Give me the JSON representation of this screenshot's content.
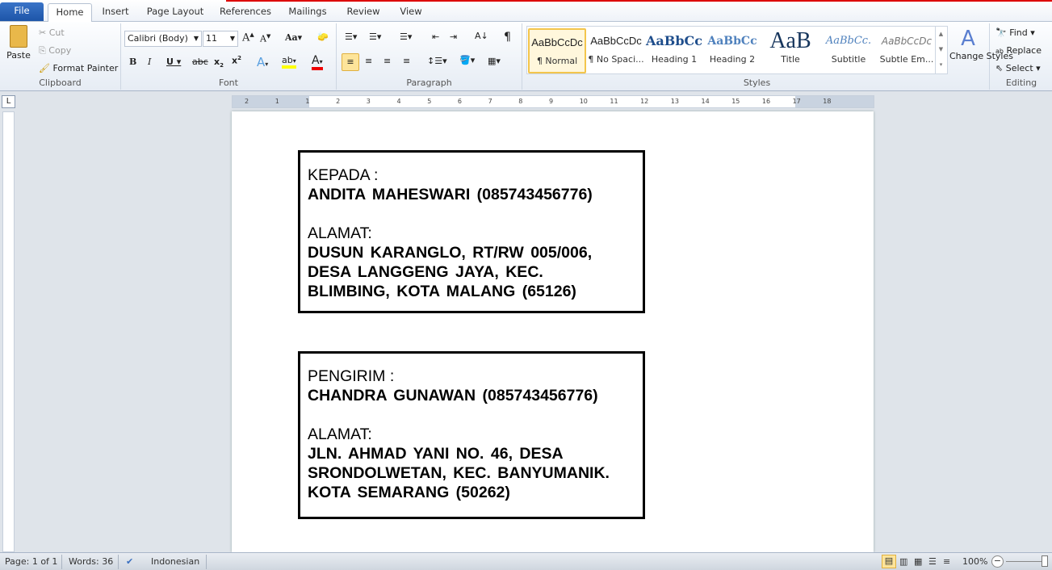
{
  "tabs": [
    "File",
    "Home",
    "Insert",
    "Page Layout",
    "References",
    "Mailings",
    "Review",
    "View"
  ],
  "clipboard": {
    "paste": "Paste",
    "cut": "Cut",
    "copy": "Copy",
    "format_painter": "Format Painter",
    "label": "Clipboard"
  },
  "font": {
    "name": "Calibri (Body)",
    "size": "11",
    "label": "Font"
  },
  "paragraph": {
    "label": "Paragraph"
  },
  "styles": {
    "label": "Styles",
    "items": [
      {
        "preview": "AaBbCcDc",
        "name": "¶ Normal"
      },
      {
        "preview": "AaBbCcDc",
        "name": "¶ No Spaci..."
      },
      {
        "preview": "AaBbCc",
        "name": "Heading 1"
      },
      {
        "preview": "AaBbCc",
        "name": "Heading 2"
      },
      {
        "preview": "AaB",
        "name": "Title"
      },
      {
        "preview": "AaBbCc.",
        "name": "Subtitle"
      },
      {
        "preview": "AaBbCcDc",
        "name": "Subtle Em..."
      }
    ],
    "change_styles": "Change Styles"
  },
  "editing": {
    "find": "Find",
    "replace": "Replace",
    "select": "Select",
    "label": "Editing"
  },
  "ruler": {
    "numbers": [
      "2",
      "1",
      "1",
      "2",
      "3",
      "4",
      "5",
      "6",
      "7",
      "8",
      "9",
      "10",
      "11",
      "12",
      "13",
      "14",
      "15",
      "16",
      "17",
      "18"
    ]
  },
  "document": {
    "recipient": {
      "label": "KEPADA :",
      "name": "ANDITA  MAHESWARI (085743456776)",
      "address_label": "ALAMAT:",
      "address": [
        "DUSUN  KARANGLO,  RT/RW 005/006,",
        "DESA LANGGENG  JAYA,  KEC.",
        "BLIMBING,  KOTA MALANG  (65126)"
      ]
    },
    "sender": {
      "label": "PENGIRIM :",
      "name": "CHANDRA  GUNAWAN  (085743456776)",
      "address_label": "ALAMAT:",
      "address": [
        "JLN. AHMAD  YANI  NO. 46, DESA",
        "SRONDOLWETAN,  KEC. BANYUMANIK.",
        "KOTA SEMARANG  (50262)"
      ]
    }
  },
  "status": {
    "page": "Page: 1 of 1",
    "words": "Words: 36",
    "language": "Indonesian",
    "zoom": "100%"
  }
}
